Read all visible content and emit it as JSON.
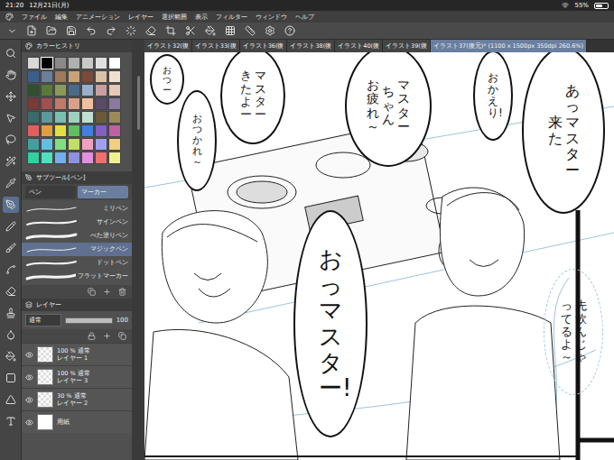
{
  "status_bar": {
    "time": "21:20",
    "date": "12月21日(月)",
    "battery": "55%",
    "battery_level": 0.55
  },
  "menu": [
    "ファイル",
    "編集",
    "アニメーション",
    "レイヤー",
    "選択範囲",
    "表示",
    "フィルター",
    "ウィンドウ",
    "ヘルプ"
  ],
  "tabs": [
    {
      "label": "イラスト32(復",
      "selected": false
    },
    {
      "label": "イラスト33(復",
      "selected": false
    },
    {
      "label": "イラスト36(復",
      "selected": false
    },
    {
      "label": "イラスト38(復",
      "selected": false
    },
    {
      "label": "イラスト40(復",
      "selected": false
    },
    {
      "label": "イラスト39(復",
      "selected": false
    },
    {
      "label": "イラスト37(復元)* (1100 x 1500px 350dpi 260.6%)",
      "selected": true
    }
  ],
  "color_panel": {
    "title": "カラーヒストリ",
    "swatches": [
      {
        "color": "#d9d9d9",
        "selected": false
      },
      {
        "color": "#000000",
        "selected": true
      },
      {
        "color": "#8a8a8a",
        "selected": false
      },
      {
        "color": "#b0b0b0",
        "selected": false
      },
      {
        "color": "#c9c9c9",
        "selected": false
      },
      {
        "color": "#e0e0e0",
        "selected": false
      },
      {
        "color": "#ffffff",
        "selected": false
      },
      {
        "color": "#3b5f8a",
        "selected": false
      },
      {
        "color": "#6a7f9a",
        "selected": false
      },
      {
        "color": "#a07a5a",
        "selected": false
      },
      {
        "color": "#c9a27a",
        "selected": false
      },
      {
        "color": "#7a4a3a",
        "selected": false
      },
      {
        "color": "#d9c2a8",
        "selected": false
      },
      {
        "color": "#f0e0d0",
        "selected": false
      },
      {
        "color": "#2f4f2f",
        "selected": false
      },
      {
        "color": "#5a7a3a",
        "selected": false
      },
      {
        "color": "#8a9a5a",
        "selected": false
      },
      {
        "color": "#4a6a8a",
        "selected": false
      },
      {
        "color": "#9ab0c9",
        "selected": false
      },
      {
        "color": "#c9a0a0",
        "selected": false
      },
      {
        "color": "#e8c8b8",
        "selected": false
      },
      {
        "color": "#7a3a3a",
        "selected": false
      },
      {
        "color": "#a05050",
        "selected": false
      },
      {
        "color": "#c07a6a",
        "selected": false
      },
      {
        "color": "#d9a08a",
        "selected": false
      },
      {
        "color": "#f0c0a0",
        "selected": false
      },
      {
        "color": "#5a4a6a",
        "selected": false
      },
      {
        "color": "#8a7aa0",
        "selected": false
      },
      {
        "color": "#3a6a6a",
        "selected": false
      },
      {
        "color": "#5a9a9a",
        "selected": false
      },
      {
        "color": "#7ac0b0",
        "selected": false
      },
      {
        "color": "#a0d0c0",
        "selected": false
      },
      {
        "color": "#c0e0d0",
        "selected": false
      },
      {
        "color": "#6a5a3a",
        "selected": false
      },
      {
        "color": "#9a8a5a",
        "selected": false
      },
      {
        "color": "#e06060",
        "selected": false
      },
      {
        "color": "#e0a040",
        "selected": false
      },
      {
        "color": "#e0e040",
        "selected": false
      },
      {
        "color": "#60c060",
        "selected": false
      },
      {
        "color": "#4080e0",
        "selected": false
      },
      {
        "color": "#8060c0",
        "selected": false
      },
      {
        "color": "#c060a0",
        "selected": false
      },
      {
        "color": "#40a0a0",
        "selected": false
      },
      {
        "color": "#60c0e0",
        "selected": false
      },
      {
        "color": "#80e080",
        "selected": false
      },
      {
        "color": "#c0e060",
        "selected": false
      },
      {
        "color": "#f0a0c0",
        "selected": false
      },
      {
        "color": "#a0a0f0",
        "selected": false
      },
      {
        "color": "#f0d080",
        "selected": false
      },
      {
        "color": "#30d0a0",
        "selected": false
      },
      {
        "color": "#50e0c0",
        "selected": false
      },
      {
        "color": "#70b0f0",
        "selected": false
      },
      {
        "color": "#9090e0",
        "selected": false
      },
      {
        "color": "#e090e0",
        "selected": false
      },
      {
        "color": "#f07070",
        "selected": false
      },
      {
        "color": "#f0f090",
        "selected": false
      }
    ]
  },
  "sub_tool": {
    "title": "サブツール[ペン]",
    "tabs": [
      {
        "label": "ペン",
        "selected": false
      },
      {
        "label": "マーカー",
        "selected": true
      }
    ],
    "brushes": [
      {
        "label": "ミリペン",
        "selected": false
      },
      {
        "label": "サインペン",
        "selected": false
      },
      {
        "label": "べた塗りペン",
        "selected": false
      },
      {
        "label": "マジックペン",
        "selected": true
      },
      {
        "label": "ドットペン",
        "selected": false
      },
      {
        "label": "フラットマーカー",
        "selected": false
      }
    ]
  },
  "layer_panel": {
    "title": "レイヤー",
    "blend": "通常",
    "opacity": "100",
    "opacity_level": 1,
    "layers": [
      {
        "kind": "layer",
        "opacity": "100 %",
        "mode": "通常",
        "name": "レイヤー 1",
        "visible": true
      },
      {
        "kind": "layer",
        "opacity": "100 %",
        "mode": "通常",
        "name": "レイヤー 3",
        "visible": true
      },
      {
        "kind": "layer",
        "opacity": "30 %",
        "mode": "通常",
        "name": "レイヤー 2",
        "visible": true
      },
      {
        "kind": "paper",
        "name": "用紙",
        "visible": true
      }
    ]
  },
  "canvas": {
    "bubbles": [
      {
        "kind": "normal",
        "columns": [
          "あっマスター",
          "来た"
        ]
      },
      {
        "kind": "normal",
        "columns": [
          "おかえり!"
        ]
      },
      {
        "kind": "normal",
        "columns": [
          "マスター",
          "ちゃん",
          "お疲れ～"
        ]
      },
      {
        "kind": "normal",
        "columns": [
          "マスター",
          "きたよー"
        ]
      },
      {
        "kind": "normal",
        "columns": [
          "おつー"
        ]
      },
      {
        "kind": "normal",
        "columns": [
          "おつかれ～"
        ]
      },
      {
        "kind": "shout",
        "columns": [
          "おっマスター!"
        ]
      },
      {
        "kind": "sketch",
        "columns": [
          "先飲んじゃ",
          "ってるよ～"
        ]
      }
    ]
  }
}
